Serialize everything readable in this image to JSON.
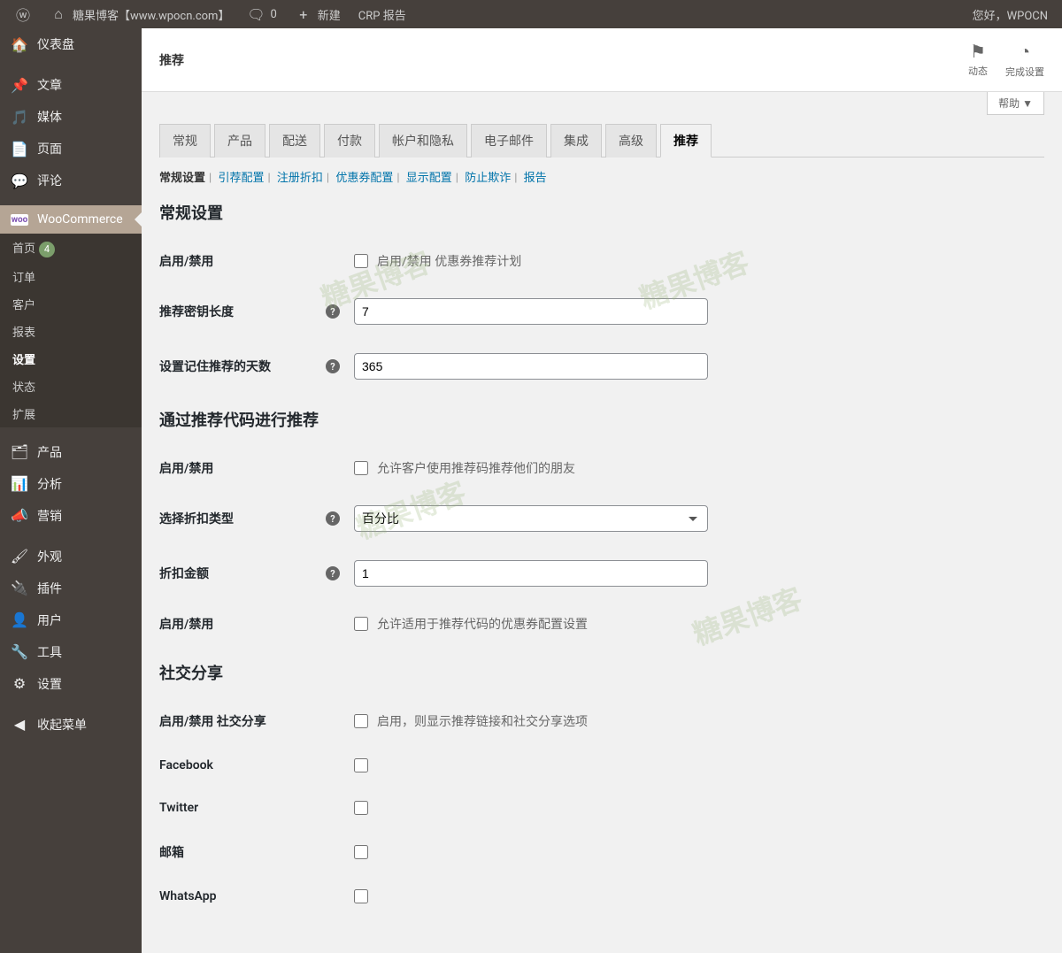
{
  "adminBar": {
    "siteName": "糖果博客【www.wpocn.com】",
    "comments": "0",
    "newLabel": "新建",
    "crpLabel": "CRP 报告",
    "greeting": "您好，WPOCN"
  },
  "sidebar": {
    "dashboard": "仪表盘",
    "posts": "文章",
    "media": "媒体",
    "pages": "页面",
    "comments": "评论",
    "woocommerce": "WooCommerce",
    "wooSub": {
      "home": "首页",
      "homeBadge": "4",
      "orders": "订单",
      "customers": "客户",
      "reports": "报表",
      "settings": "设置",
      "status": "状态",
      "extensions": "扩展"
    },
    "products": "产品",
    "analytics": "分析",
    "marketing": "营销",
    "appearance": "外观",
    "plugins": "插件",
    "users": "用户",
    "tools": "工具",
    "settings2": "设置",
    "collapse": "收起菜单"
  },
  "header": {
    "title": "推荐",
    "action1": "动态",
    "action2": "完成设置",
    "help": "帮助 ▼"
  },
  "tabs": {
    "general": "常规",
    "products": "产品",
    "shipping": "配送",
    "payments": "付款",
    "accounts": "帐户和隐私",
    "emails": "电子邮件",
    "integration": "集成",
    "advanced": "高级",
    "referral": "推荐"
  },
  "subLinks": {
    "general": "常规设置",
    "referralConfig": "引荐配置",
    "signupDiscount": "注册折扣",
    "couponConfig": "优惠券配置",
    "displayConfig": "显示配置",
    "fraudPrevent": "防止欺诈",
    "report": "报告"
  },
  "sections": {
    "general": "常规设置",
    "referByCode": "通过推荐代码进行推荐",
    "socialShare": "社交分享"
  },
  "fields": {
    "enableDisable": "启用/禁用",
    "enablePlanDesc": "启用/禁用 优惠券推荐计划",
    "keyLength": "推荐密钥长度",
    "keyLengthValue": "7",
    "rememberDays": "设置记住推荐的天数",
    "rememberDaysValue": "365",
    "allowFriendsDesc": "允许客户使用推荐码推荐他们的朋友",
    "discountType": "选择折扣类型",
    "discountTypeValue": "百分比",
    "discountAmount": "折扣金额",
    "discountAmountValue": "1",
    "allowCouponDesc": "允许适用于推荐代码的优惠券配置设置",
    "enableSocial": "启用/禁用 社交分享",
    "enableSocialDesc": "启用，则显示推荐链接和社交分享选项",
    "facebook": "Facebook",
    "twitter": "Twitter",
    "email": "邮箱",
    "whatsapp": "WhatsApp"
  },
  "watermarkText": "糖果博客"
}
